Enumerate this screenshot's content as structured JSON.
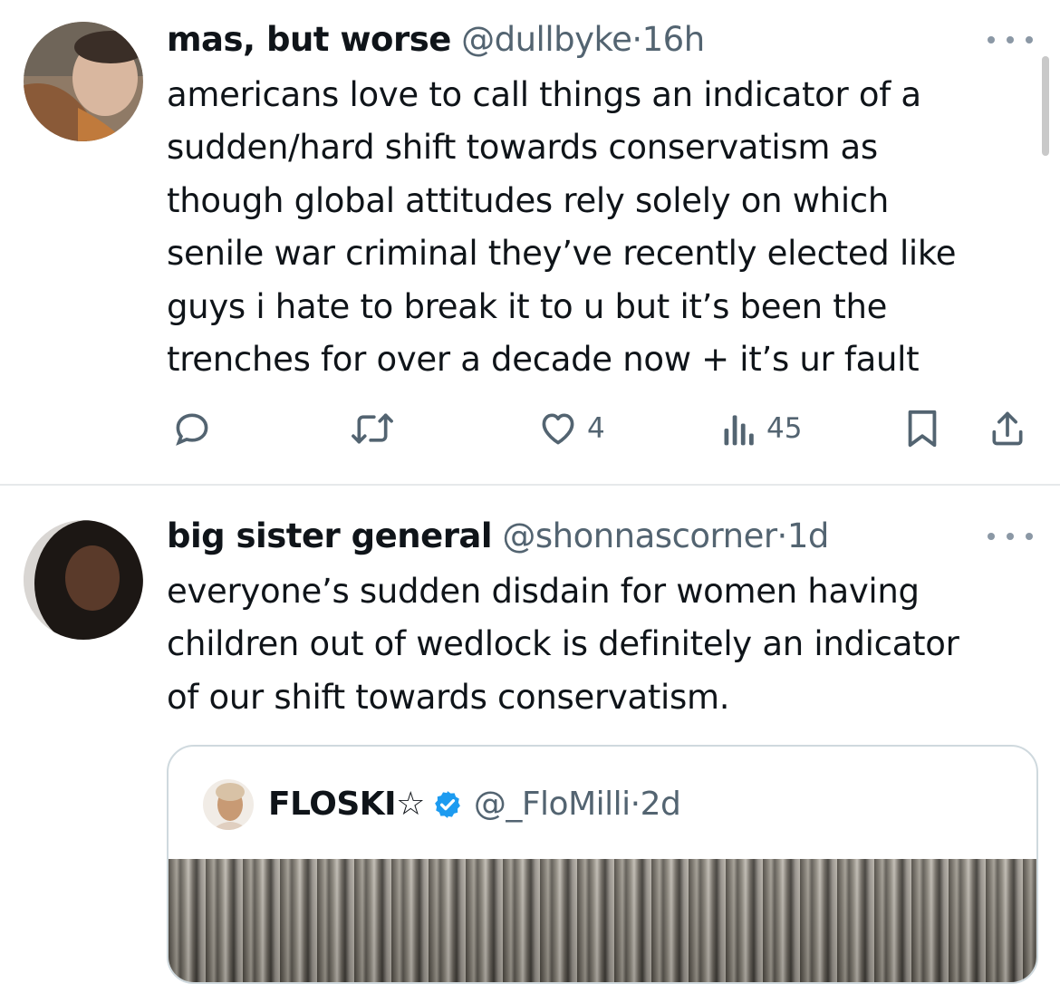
{
  "tweets": [
    {
      "display_name": "mas, but worse",
      "handle": "@dullbyke",
      "separator": "·",
      "time": "16h",
      "text": "americans love to call things an indicator of a\nsudden/hard shift towards conservatism as\nthough global attitudes rely solely on which\nsenile war criminal they’ve recently elected like\nguys i hate to break it to u but it’s been the\ntrenches for over a decade now + it’s ur fault",
      "likes": "4",
      "views": "45"
    },
    {
      "display_name": "big sister general",
      "handle": "@shonnascorner",
      "separator": "·",
      "time": "1d",
      "text": "everyone’s sudden disdain for women having\nchildren out of wedlock is definitely an indicator\nof our shift towards conservatism.",
      "quote": {
        "display_name": "FLOSKI☆",
        "handle": "@_FloMilli",
        "separator": "·",
        "time": "2d"
      }
    }
  ],
  "icons": [
    "reply-icon",
    "retweet-icon",
    "like-icon",
    "views-icon",
    "bookmark-icon",
    "share-icon",
    "more-icon",
    "verified-badge-icon"
  ],
  "colors": {
    "text": "#0f1419",
    "secondary": "#536471",
    "verified": "#1d9bf0",
    "divider": "#e6e9eb"
  }
}
